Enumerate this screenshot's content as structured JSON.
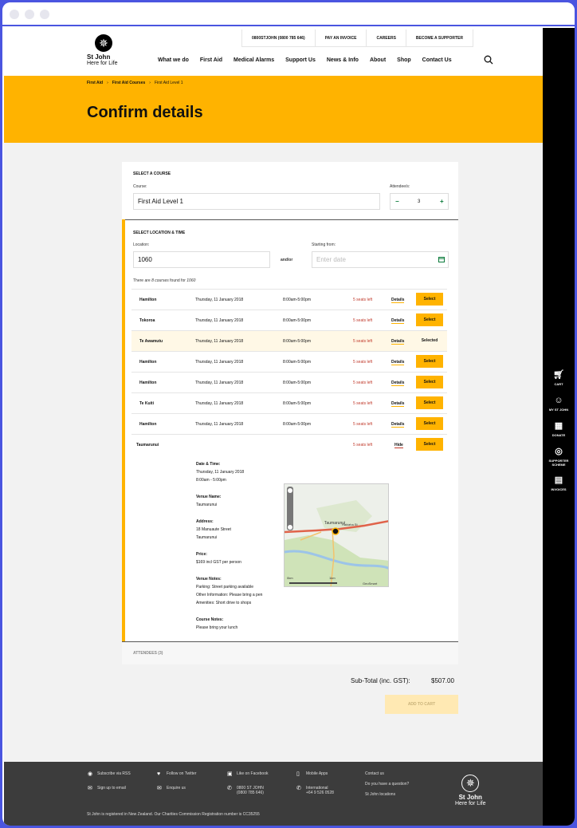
{
  "toplinks": [
    "0800STJOHN (0800 785 646)",
    "PAY AN INVOICE",
    "CAREERS",
    "BECOME A SUPPORTER"
  ],
  "brand": {
    "name": "St John",
    "tagline": "Here for Life"
  },
  "nav": [
    "What we do",
    "First Aid",
    "Medical Alarms",
    "Support Us",
    "News & Info",
    "About",
    "Shop",
    "Contact Us"
  ],
  "breadcrumb": [
    "First Aid",
    "First Aid Courses",
    "First Aid Level 1"
  ],
  "page_title": "Confirm details",
  "course": {
    "section": "SELECT A COURSE",
    "course_label": "Course:",
    "course_value": "First Aid Level 1",
    "attendees_label": "Attendee/s:",
    "attendees_minus": "−",
    "attendees_value": "3",
    "attendees_plus": "+"
  },
  "location": {
    "section": "SELECT LOCATION & TIME",
    "location_label": "Location:",
    "location_value": "1060",
    "andor": "and/or",
    "start_label": "Starting from:",
    "start_placeholder": "Enter date",
    "found_prefix": "There are ",
    "found_count": "8 courses",
    "found_mid": " found for ",
    "found_query": "1060"
  },
  "results": [
    {
      "place": "Hamilton",
      "date": "Thursday, 11 January 2018",
      "time": "8:00am-5:00pm",
      "seats": "5 seats left",
      "details": "Details",
      "action": "Select"
    },
    {
      "place": "Tokoroa",
      "date": "Thursday, 11 January 2018",
      "time": "8:00am-5:00pm",
      "seats": "5 seats left",
      "details": "Details",
      "action": "Select"
    },
    {
      "place": "Te Awamutu",
      "date": "Thursday, 11 January 2018",
      "time": "8:00am-5:00pm",
      "seats": "5 seats left",
      "details": "Details",
      "action": "Selected"
    },
    {
      "place": "Hamilton",
      "date": "Thursday, 11 January 2018",
      "time": "8:00am-5:00pm",
      "seats": "5 seats left",
      "details": "Details",
      "action": "Select"
    },
    {
      "place": "Hamilton",
      "date": "Thursday, 11 January 2018",
      "time": "8:00am-5:00pm",
      "seats": "5 seats left",
      "details": "Details",
      "action": "Select"
    },
    {
      "place": "Te Kuiti",
      "date": "Thursday, 11 January 2018",
      "time": "8:00am-5:00pm",
      "seats": "5 seats left",
      "details": "Details",
      "action": "Select"
    },
    {
      "place": "Hamilton",
      "date": "Thursday, 11 January 2018",
      "time": "8:00am-5:00pm",
      "seats": "5 seats left",
      "details": "Details",
      "action": "Select"
    }
  ],
  "expanded": {
    "place": "Taumarunui",
    "seats": "5 seats left",
    "hide": "Hide",
    "action": "Select",
    "date_label": "Date & Time:",
    "date_line1": "Thursday, 11 January 2018",
    "date_line2": "8:00am - 5:00pm",
    "venue_label": "Venue Name:",
    "venue": "Taumarunui",
    "address_label": "Address:",
    "address1": "18 Manuaute Street",
    "address2": "Taumarunui",
    "price_label": "Price:",
    "price": "$169 incl GST per person",
    "notes_label": "Venue Notes:",
    "notes1": "Parking: Street parking available",
    "notes2": "Other Information: Please bring a pen",
    "notes3": "Amenities: Short drive to shops",
    "course_notes_label": "Course Notes:",
    "course_notes": "Please bring your lunch",
    "map": {
      "town": "Taumarunui",
      "street": "Hakiaha St",
      "scale_0": "0km",
      "scale_1": "1km",
      "credit": "GeoSmart"
    }
  },
  "attendees_section": "ATTENDEES (3)",
  "subtotal_label": "Sub-Total (inc. GST):",
  "subtotal_value": "$507.00",
  "add_to_cart": "ADD TO CART",
  "sidebar": [
    "CART",
    "MY ST JOHN",
    "DONATE",
    "SUPPORTER SCHEME",
    "INVOICES"
  ],
  "footer": {
    "rss": "Subscribe via RSS",
    "email": "Sign up to email",
    "twitter": "Follow on Twitter",
    "enquire": "Enquire us",
    "facebook": "Like on Facebook",
    "phone1": "0800 ST JOHN",
    "phone2": "(0800 785 646)",
    "apps": "Mobile Apps",
    "intl1": "International",
    "intl2": "+64 9 526 0528",
    "contact": "Contact us",
    "question": "Do you have a question?",
    "locations": "St John locations",
    "registration": "St John is registered in New Zealand. Our Charities Commission Registration number is CC35255"
  }
}
